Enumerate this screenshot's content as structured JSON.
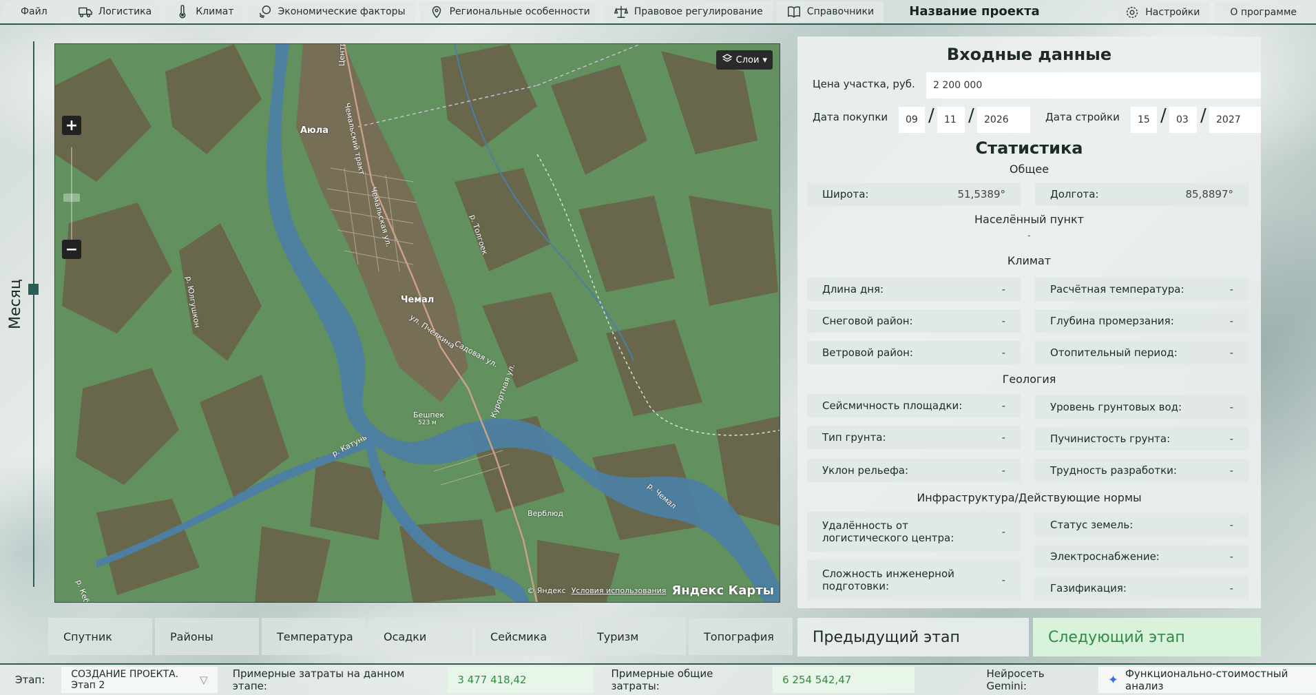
{
  "menu": {
    "file": "Файл",
    "items": [
      {
        "label": "Логистика",
        "icon": "truck-icon"
      },
      {
        "label": "Климат",
        "icon": "thermometer-icon"
      },
      {
        "label": "Экономические факторы",
        "icon": "coins-icon"
      },
      {
        "label": "Региональные особенности",
        "icon": "location-pin-icon"
      },
      {
        "label": "Правовое регулирование",
        "icon": "scales-icon"
      },
      {
        "label": "Справочники",
        "icon": "book-icon"
      }
    ],
    "project_title": "Название проекта",
    "settings": "Настройки",
    "about": "О программе"
  },
  "slider": {
    "label": "Месяц"
  },
  "map": {
    "layers_label": "Слои",
    "zoom_in": "+",
    "zoom_out": "−",
    "places": {
      "ayula": "Аюла",
      "chemal": "Чемал",
      "beshpek": "Бешпек",
      "beshpek_height": "523 м",
      "verblyud": "Верблюд",
      "road1": "Централ",
      "road2": "Чемальский тракт",
      "road3": "Чемальская ул.",
      "road4": "ул. Пчёлкина",
      "road5": "Садовая ул.",
      "road6": "Курортная ул.",
      "river1": "р. Толгоек",
      "river2": "р. Юлгушкон",
      "river3": "р. Катунь",
      "river4": "р. Чемал",
      "river5": "р. Кеба"
    },
    "copyright": "© Яндекс",
    "terms": "Условия использования",
    "brand": "Яндекс Карты"
  },
  "map_tabs": [
    "Спутник",
    "Районы",
    "Температура",
    "Осадки",
    "Сейсмика",
    "Туризм",
    "Топография"
  ],
  "panel": {
    "title": "Входные данные",
    "price_label": "Цена участка, руб.",
    "price_value": "2 200 000",
    "purchase_label": "Дата покупки",
    "purchase": {
      "day": "09",
      "month": "11",
      "year": "2026"
    },
    "build_label": "Дата стройки",
    "build": {
      "day": "15",
      "month": "03",
      "year": "2027"
    },
    "stats_title": "Статистика",
    "general_title": "Общее",
    "lat_label": "Широта:",
    "lat_value": "51,5389°",
    "lon_label": "Долгота:",
    "lon_value": "85,8897°",
    "locality_title": "Населённый пункт",
    "locality_value": "-",
    "climate_title": "Климат",
    "climate": [
      {
        "label": "Длина дня:",
        "value": "-"
      },
      {
        "label": "Расчётная температура:",
        "value": "-"
      },
      {
        "label": "Снеговой район:",
        "value": "-"
      },
      {
        "label": "Глубина промерзания:",
        "value": "-"
      },
      {
        "label": "Ветровой район:",
        "value": "-"
      },
      {
        "label": "Отопительный период:",
        "value": "-"
      }
    ],
    "geology_title": "Геология",
    "geology": [
      {
        "label": "Сейсмичность площадки:",
        "value": "-"
      },
      {
        "label": "Уровень грунтовых вод:",
        "value": "-"
      },
      {
        "label": "Тип грунта:",
        "value": "-"
      },
      {
        "label": "Пучинистость грунта:",
        "value": "-"
      },
      {
        "label": "Уклон рельефа:",
        "value": "-"
      },
      {
        "label": "Трудность разработки:",
        "value": "-"
      }
    ],
    "infra_title": "Инфраструктура/Действующие нормы",
    "infra": [
      {
        "label": "Удалённость от логистического центра:",
        "value": "-"
      },
      {
        "label": "Статус земель:",
        "value": "-"
      },
      {
        "label": "Электроснабжение:",
        "value": "-"
      },
      {
        "label": "Сложность инженерной подготовки:",
        "value": "-"
      },
      {
        "label": "Газификация:",
        "value": "-"
      }
    ]
  },
  "stage_buttons": {
    "prev": "Предыдущий этап",
    "next": "Следующий этап"
  },
  "status": {
    "stage_label": "Этап:",
    "stage_value": "СОЗДАНИЕ ПРОЕКТА. Этап 2",
    "cost_stage_label": "Примерные затраты на данном этапе:",
    "cost_stage_value": "3 477 418,42",
    "cost_total_label": "Примерные общие затраты:",
    "cost_total_value": "6 254 542,47",
    "ai_label": "Нейросеть Gemini:",
    "ai_button": "Функционально-стоимостный анализ"
  },
  "colors": {
    "accent": "#2d5c55",
    "next_bg": "#d9f2dc",
    "next_text": "#2f8a45"
  }
}
